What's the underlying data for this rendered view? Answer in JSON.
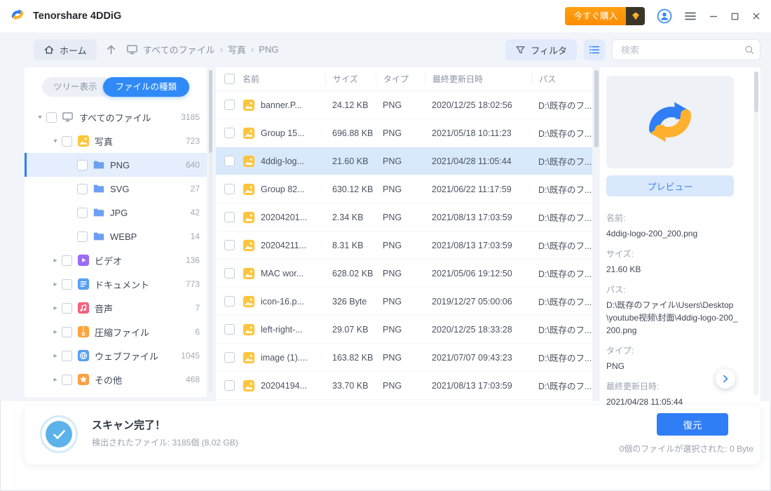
{
  "titlebar": {
    "app_name": "Tenorshare 4DDiG",
    "buy_label": "今すぐ購入"
  },
  "toolbar": {
    "home_label": "ホーム",
    "breadcrumb": [
      "すべてのファイル",
      "写真",
      "PNG"
    ],
    "breadcrumb_separator": "›",
    "filter_label": "フィルタ",
    "search_placeholder": "検索"
  },
  "sidebar": {
    "tabs": [
      {
        "label": "ツリー表示",
        "active": false
      },
      {
        "label": "ファイルの種類",
        "active": true
      }
    ],
    "tree": [
      {
        "label": "すべてのファイル",
        "count": "3185",
        "level": 0,
        "caret": "expanded",
        "icon": "monitor-icon",
        "selected": false
      },
      {
        "label": "写真",
        "count": "723",
        "level": 1,
        "caret": "expanded",
        "icon": "photo-icon",
        "selected": false
      },
      {
        "label": "PNG",
        "count": "640",
        "level": 2,
        "caret": "none",
        "icon": "folder-icon",
        "selected": true
      },
      {
        "label": "SVG",
        "count": "27",
        "level": 2,
        "caret": "none",
        "icon": "folder-icon",
        "selected": false
      },
      {
        "label": "JPG",
        "count": "42",
        "level": 2,
        "caret": "none",
        "icon": "folder-icon",
        "selected": false
      },
      {
        "label": "WEBP",
        "count": "14",
        "level": 2,
        "caret": "none",
        "icon": "folder-icon",
        "selected": false
      },
      {
        "label": "ビデオ",
        "count": "136",
        "level": 1,
        "caret": "collapsed",
        "icon": "video-icon",
        "selected": false
      },
      {
        "label": "ドキュメント",
        "count": "773",
        "level": 1,
        "caret": "collapsed",
        "icon": "document-icon",
        "selected": false
      },
      {
        "label": "音声",
        "count": "7",
        "level": 1,
        "caret": "collapsed",
        "icon": "audio-icon",
        "selected": false
      },
      {
        "label": "圧縮ファイル",
        "count": "6",
        "level": 1,
        "caret": "collapsed",
        "icon": "archive-icon",
        "selected": false
      },
      {
        "label": "ウェブファイル",
        "count": "1045",
        "level": 1,
        "caret": "collapsed",
        "icon": "web-icon",
        "selected": false
      },
      {
        "label": "その他",
        "count": "468",
        "level": 1,
        "caret": "collapsed",
        "icon": "star-icon",
        "selected": false
      }
    ]
  },
  "table": {
    "headers": [
      "名前",
      "サイズ",
      "タイプ",
      "最終更新日時",
      "パス"
    ],
    "rows": [
      {
        "name": "banner.P...",
        "size": "24.12 KB",
        "type": "PNG",
        "modified": "2020/12/25 18:02:56",
        "path": "D:\\既存のフ...",
        "selected": false
      },
      {
        "name": "Group 15...",
        "size": "696.88 KB",
        "type": "PNG",
        "modified": "2021/05/18 10:11:23",
        "path": "D:\\既存のフ...",
        "selected": false
      },
      {
        "name": "4ddig-log...",
        "size": "21.60 KB",
        "type": "PNG",
        "modified": "2021/04/28 11:05:44",
        "path": "D:\\既存のフ...",
        "selected": true
      },
      {
        "name": "Group 82...",
        "size": "630.12 KB",
        "type": "PNG",
        "modified": "2021/06/22 11:17:59",
        "path": "D:\\既存のフ...",
        "selected": false
      },
      {
        "name": "20204201...",
        "size": "2.34 KB",
        "type": "PNG",
        "modified": "2021/08/13 17:03:59",
        "path": "D:\\既存のフ...",
        "selected": false
      },
      {
        "name": "20204211...",
        "size": "8.31 KB",
        "type": "PNG",
        "modified": "2021/08/13 17:03:59",
        "path": "D:\\既存のフ...",
        "selected": false
      },
      {
        "name": "MAC wor...",
        "size": "628.02 KB",
        "type": "PNG",
        "modified": "2021/05/06 19:12:50",
        "path": "D:\\既存のフ...",
        "selected": false
      },
      {
        "name": "icon-16.p...",
        "size": "326 Byte",
        "type": "PNG",
        "modified": "2019/12/27 05:00:06",
        "path": "D:\\既存のフ...",
        "selected": false
      },
      {
        "name": "left-right-...",
        "size": "29.07 KB",
        "type": "PNG",
        "modified": "2020/12/25 18:33:28",
        "path": "D:\\既存のフ...",
        "selected": false
      },
      {
        "name": "image (1)....",
        "size": "163.82 KB",
        "type": "PNG",
        "modified": "2021/07/07 09:43:23",
        "path": "D:\\既存のフ...",
        "selected": false
      },
      {
        "name": "20204194...",
        "size": "33.70 KB",
        "type": "PNG",
        "modified": "2021/08/13 17:03:59",
        "path": "D:\\既存のフ...",
        "selected": false
      }
    ]
  },
  "preview": {
    "button_label": "プレビュー",
    "fields": [
      {
        "label": "名前:",
        "value": "4ddig-logo-200_200.png"
      },
      {
        "label": "サイズ:",
        "value": "21.60 KB"
      },
      {
        "label": "パス:",
        "value": "D:\\既存のファイル\\Users\\Desktop\\youtube视频\\封面\\4ddig-logo-200_200.png"
      },
      {
        "label": "タイプ:",
        "value": "PNG"
      },
      {
        "label": "最終更新日時:",
        "value": "2021/04/28 11:05:44"
      }
    ]
  },
  "footer": {
    "status_title": "スキャン完了！",
    "status_detail": "検出されたファイル: 3185個 (8.02 GB)",
    "recover_label": "復元",
    "selection_info": "0個のファイルが選択された: 0 Byte"
  },
  "colors": {
    "accent": "#2f7ef6",
    "buy_orange": "#ff8d00",
    "logo_blue": "#2f7ef6",
    "logo_yellow": "#ffb12e",
    "selected_row": "#d9e9fc"
  }
}
